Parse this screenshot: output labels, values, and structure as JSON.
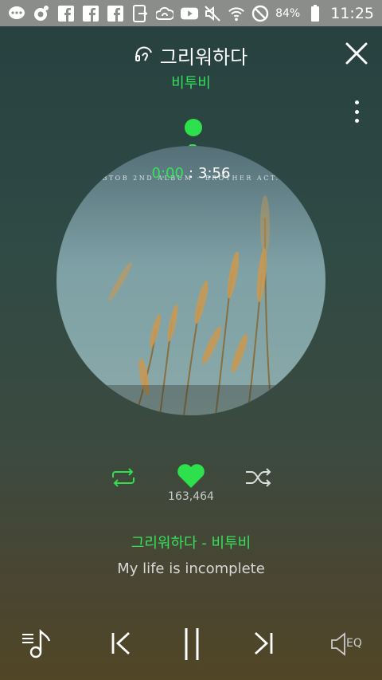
{
  "status_bar": {
    "icons": [
      "chat-bubble-icon",
      "music-app-icon",
      "facebook-icon",
      "facebook-icon",
      "facebook-icon",
      "phone-transfer-icon",
      "cloud-icon",
      "youtube-icon"
    ],
    "right_icons": [
      "mute-icon",
      "wifi-icon",
      "no-disturb-icon",
      "battery-icon"
    ],
    "battery": "84%",
    "time": "11:25"
  },
  "header": {
    "title": "그리워하다",
    "artist": "비투비"
  },
  "album": {
    "caption": "BTOB 2ND ALBUM · BROTHER ACT."
  },
  "player": {
    "current_time": "0:00",
    "separator": ":",
    "total_time": "3:56",
    "progress": 0
  },
  "actions": {
    "like_count": "163,464"
  },
  "now_playing": {
    "song_line": "그리워하다 - 비투비",
    "lyric": "My life is incomplete"
  },
  "controls": {
    "eq_label": "EQ"
  },
  "colors": {
    "accent": "#2ee04b",
    "status_bar": "#8a8d8a"
  }
}
